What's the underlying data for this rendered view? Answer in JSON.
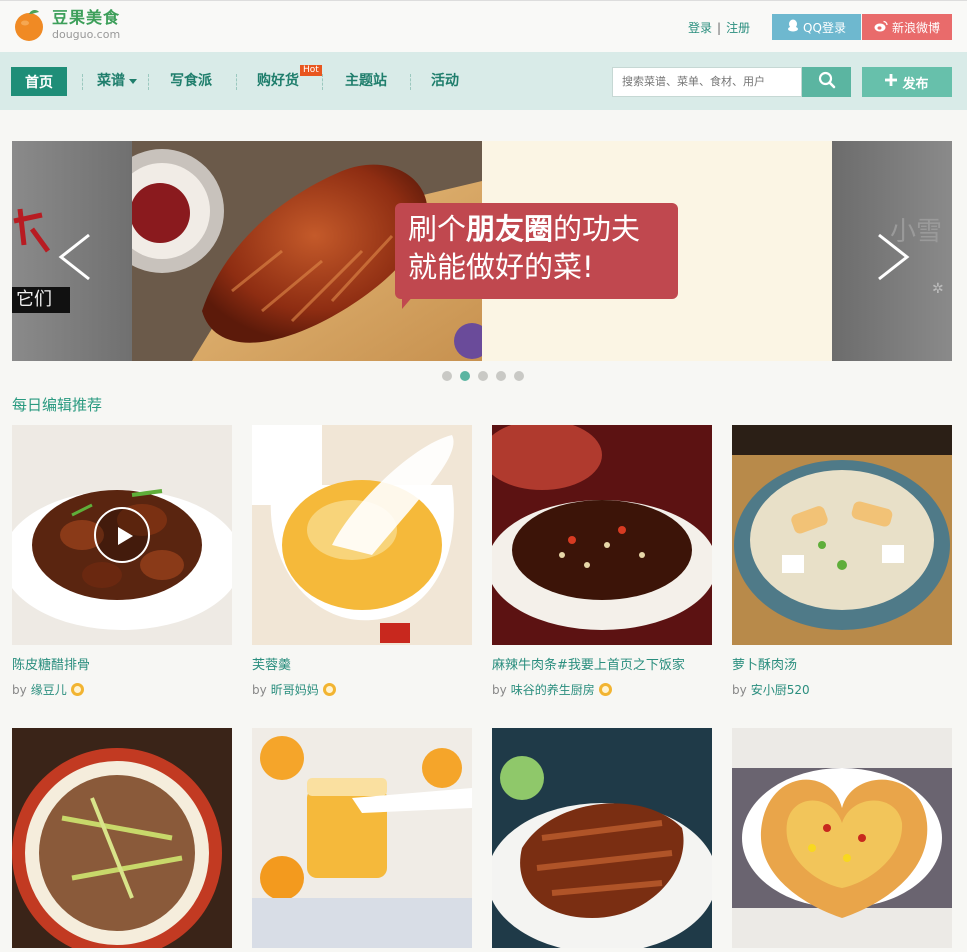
{
  "brand": {
    "name_cn": "豆果美食",
    "domain": "douguo.com"
  },
  "auth": {
    "login": "登录",
    "separator": "|",
    "register": "注册",
    "qq_login": "QQ登录",
    "weibo_login": "新浪微博"
  },
  "nav": {
    "home": "首页",
    "recipes": "菜谱",
    "food_writing": "写食派",
    "shopping": "购好货",
    "hot_badge": "Hot",
    "themes": "主题站",
    "events": "活动"
  },
  "search": {
    "placeholder": "搜索菜谱、菜单、食材、用户"
  },
  "publish": {
    "label": "发布"
  },
  "banner": {
    "line1_a": "刷个",
    "line1_b": "朋友圈",
    "line1_c": "的功夫",
    "line2": "就能做好的菜!",
    "left_partial": "它们",
    "right_partial": "小雪",
    "dots": [
      false,
      true,
      false,
      false,
      false
    ]
  },
  "section": {
    "title": "每日编辑推荐"
  },
  "cards": [
    {
      "title": "陈皮糖醋排骨",
      "by": "by",
      "author": "缘豆儿",
      "vip": true,
      "video": true
    },
    {
      "title": "芙蓉羹",
      "by": "by",
      "author": "昕哥妈妈",
      "vip": true,
      "video": false
    },
    {
      "title": "麻辣牛肉条#我要上首页之下饭家",
      "by": "by",
      "author": "味谷的养生厨房",
      "vip": true,
      "video": false
    },
    {
      "title": "萝卜酥肉汤",
      "by": "by",
      "author": "安小厨520",
      "vip": false,
      "video": false
    }
  ],
  "colors": {
    "accent": "#1f8e78",
    "nav_bg": "#d9ebe8",
    "qq": "#6eb8cf",
    "weibo": "#e96b6b",
    "hot": "#e8561f",
    "bubble": "#c0484f"
  }
}
